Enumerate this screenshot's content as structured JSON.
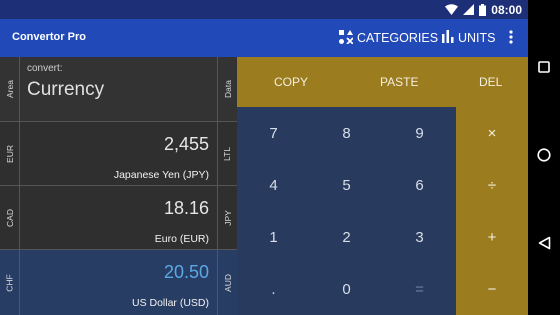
{
  "status": {
    "time": "08:00"
  },
  "appbar": {
    "title": "Convertor Pro",
    "categories_label": "CATEGORIES",
    "units_label": "UNITS"
  },
  "header": {
    "left_tab": "Area",
    "right_tab": "Data",
    "convert_label": "convert:",
    "category": "Currency"
  },
  "rows": [
    {
      "left_tab": "EUR",
      "right_tab": "LTL",
      "value": "2,455",
      "unit": "Japanese Yen (JPY)"
    },
    {
      "left_tab": "CAD",
      "right_tab": "JPY",
      "value": "18.16",
      "unit": "Euro (EUR)"
    },
    {
      "left_tab": "CHF",
      "right_tab": "AUD",
      "value": "20.50",
      "unit": "US Dollar (USD)"
    }
  ],
  "toolbar": {
    "copy": "COPY",
    "paste": "PASTE",
    "del": "DEL"
  },
  "keypad": {
    "k7": "7",
    "k8": "8",
    "k9": "9",
    "k4": "4",
    "k5": "5",
    "k6": "6",
    "k1": "1",
    "k2": "2",
    "k3": "3",
    "kdot": ".",
    "k0": "0",
    "keq": "="
  },
  "operators": {
    "multiply": "×",
    "divide": "÷",
    "plus": "+",
    "minus": "−"
  },
  "colors": {
    "appbar": "#2149b8",
    "statusbar": "#1d2f77",
    "accent_gold": "#9b7c1e",
    "keypad": "#283a5e",
    "active_value": "#5aa8e6"
  }
}
